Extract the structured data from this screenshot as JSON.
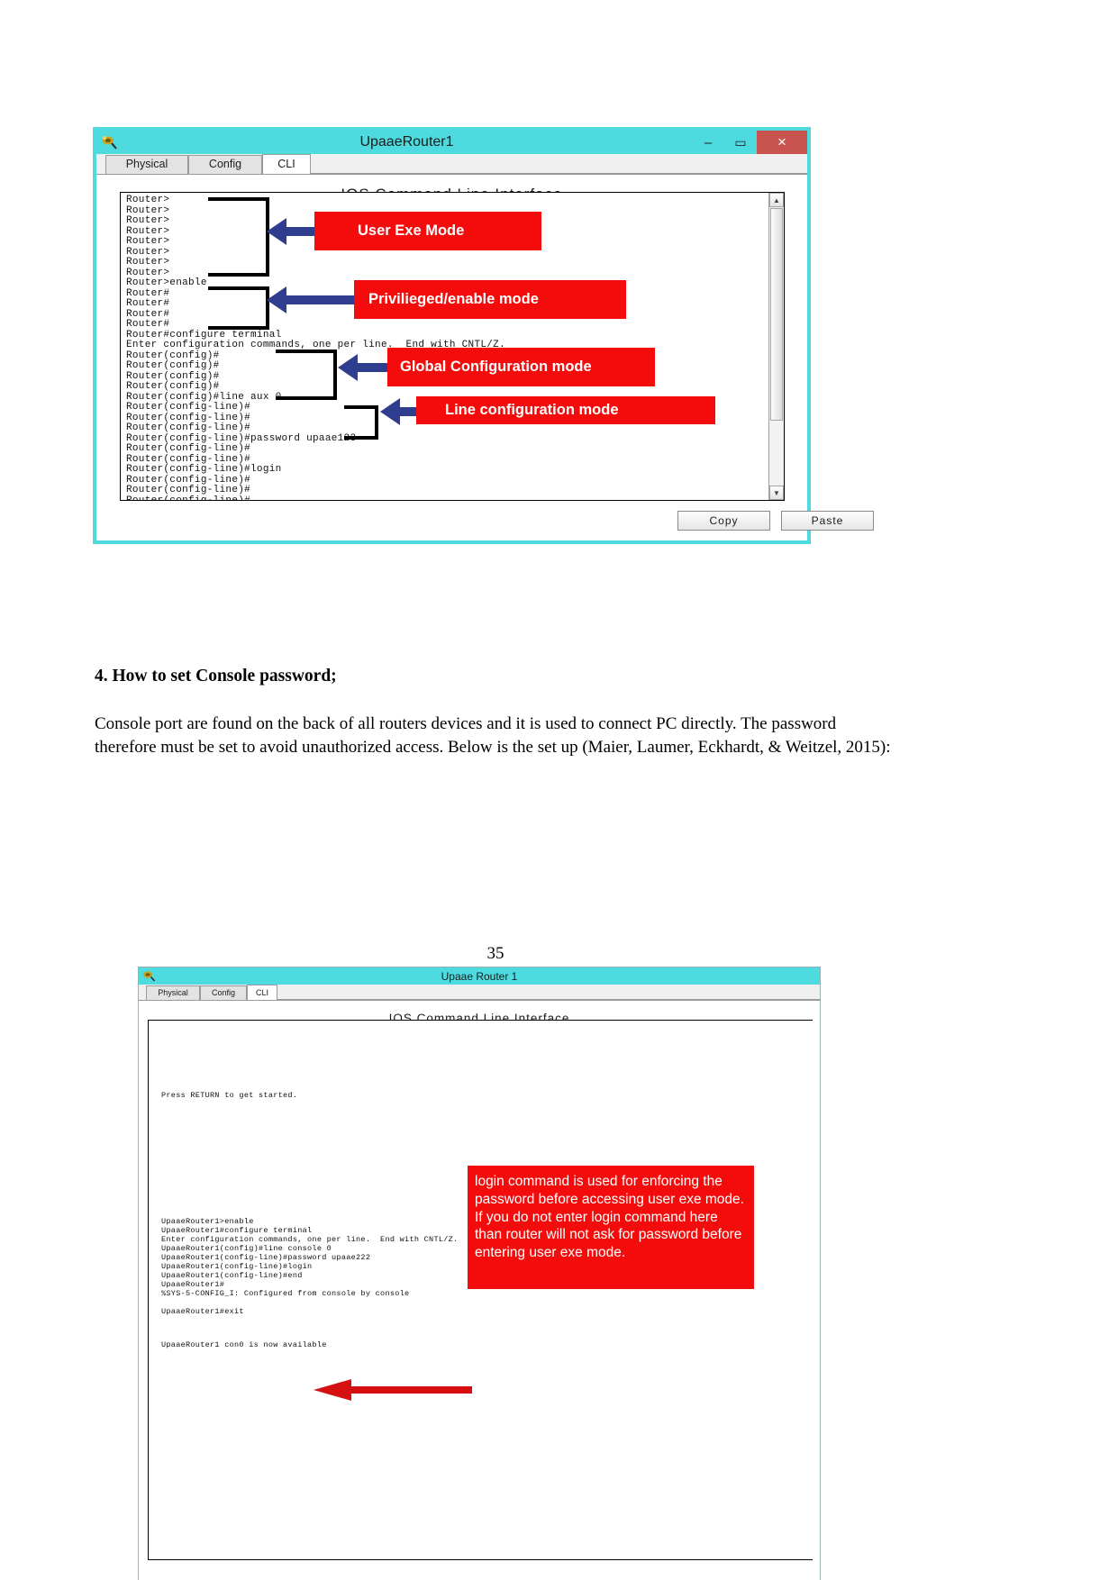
{
  "document": {
    "page_number": "35",
    "section_heading": "4. How to set Console password;",
    "body_paragraph": "Console port are found on the back of all routers devices and it is used to connect PC directly. The password therefore must be set to avoid unauthorized access. Below is the set up (Maier, Laumer, Eckhardt, & Weitzel, 2015):"
  },
  "colors": {
    "titlebar": "#4ddbe0",
    "callout_red": "#f40c0c",
    "arrow_blue": "#2f3d8f",
    "arrow_red": "#d61010",
    "close_button": "#c9534f"
  },
  "figure1": {
    "window_title": "UpaaeRouter1",
    "app_icon": "packet-tracer-icon",
    "window_buttons": {
      "minimize": "–",
      "maximize": "▭",
      "close": "×"
    },
    "tabs": [
      {
        "label": "Physical",
        "active": false
      },
      {
        "label": "Config",
        "active": false
      },
      {
        "label": "CLI",
        "active": true
      }
    ],
    "panel_title": "IOS Command Line Interface",
    "console_lines": [
      "Router>",
      "Router>",
      "Router>",
      "Router>",
      "Router>",
      "Router>",
      "Router>",
      "Router>",
      "Router>enable",
      "Router#",
      "Router#",
      "Router#",
      "Router#",
      "Router#configure terminal",
      "Enter configuration commands, one per line.  End with CNTL/Z.",
      "Router(config)#",
      "Router(config)#",
      "Router(config)#",
      "Router(config)#",
      "Router(config)#line aux 0",
      "Router(config-line)#",
      "Router(config-line)#",
      "Router(config-line)#",
      "Router(config-line)#password upaae123",
      "Router(config-line)#",
      "Router(config-line)#",
      "Router(config-line)#login",
      "Router(config-line)#",
      "Router(config-line)#",
      "Router(config-line)#"
    ],
    "callouts": [
      {
        "label": "User Exe Mode"
      },
      {
        "label": "Privilieged/enable mode"
      },
      {
        "label": "Global Configuration mode"
      },
      {
        "label": "Line configuration mode"
      }
    ],
    "buttons": [
      {
        "label": "Copy"
      },
      {
        "label": "Paste"
      }
    ],
    "scrollbar": {
      "up_arrow": "▲",
      "down_arrow": "▼"
    }
  },
  "figure2": {
    "window_title": "Upaae Router 1",
    "app_icon": "packet-tracer-icon",
    "tabs": [
      {
        "label": "Physical",
        "active": false
      },
      {
        "label": "Config",
        "active": false
      },
      {
        "label": "CLI",
        "active": true
      }
    ],
    "panel_title": "IOS Command Line Interface",
    "console_top_line": "Press RETURN to get started.",
    "console_lines": [
      "UpaaeRouter1>enable",
      "UpaaeRouter1#configure terminal",
      "Enter configuration commands, one per line.  End with CNTL/Z.",
      "UpaaeRouter1(config)#line console 0",
      "UpaaeRouter1(config-line)#password upaae222",
      "UpaaeRouter1(config-line)#login",
      "UpaaeRouter1(config-line)#end",
      "UpaaeRouter1#",
      "%SYS-5-CONFIG_I: Configured from console by console",
      "",
      "UpaaeRouter1#exit"
    ],
    "console_footer_line": "UpaaeRouter1 con0 is now available",
    "callout": "login command is used for enforcing the password before accessing user exe mode. If you do not enter login command here than router will not ask for password before entering user exe mode."
  }
}
